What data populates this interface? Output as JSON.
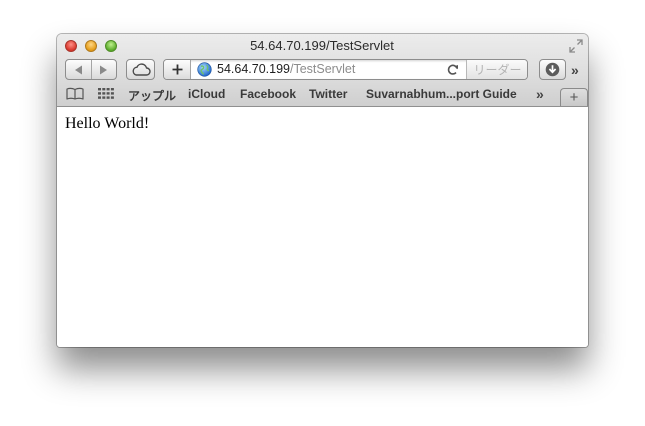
{
  "window": {
    "title": "54.64.70.199/TestServlet"
  },
  "toolbar": {
    "back_icon": "back-arrow-icon",
    "forward_icon": "forward-arrow-icon",
    "icloud_tabs_icon": "cloud-icon",
    "add_icon": "plus-icon",
    "url_host": "54.64.70.199",
    "url_path": "/TestServlet",
    "reader_label": "リーダー",
    "downloads_icon": "download-icon",
    "overflow_label": "»"
  },
  "bookmarks_bar": {
    "reading_list_icon": "book-icon",
    "top_sites_icon": "grid-icon",
    "items": [
      "アップル",
      "iCloud",
      "Facebook",
      "Twitter",
      "Suvarnabhum...port Guide"
    ],
    "more_label": "»",
    "new_tab_label": "+"
  },
  "page": {
    "body_text": "Hello World!"
  },
  "colors": {
    "chrome_top": "#ececec",
    "chrome_bottom": "#cfcfcf",
    "close": "#d8362b",
    "minimize": "#e49b16",
    "zoom": "#5aab2a",
    "url_path": "#8c8c8c",
    "reader_disabled": "#b4b4b4"
  }
}
